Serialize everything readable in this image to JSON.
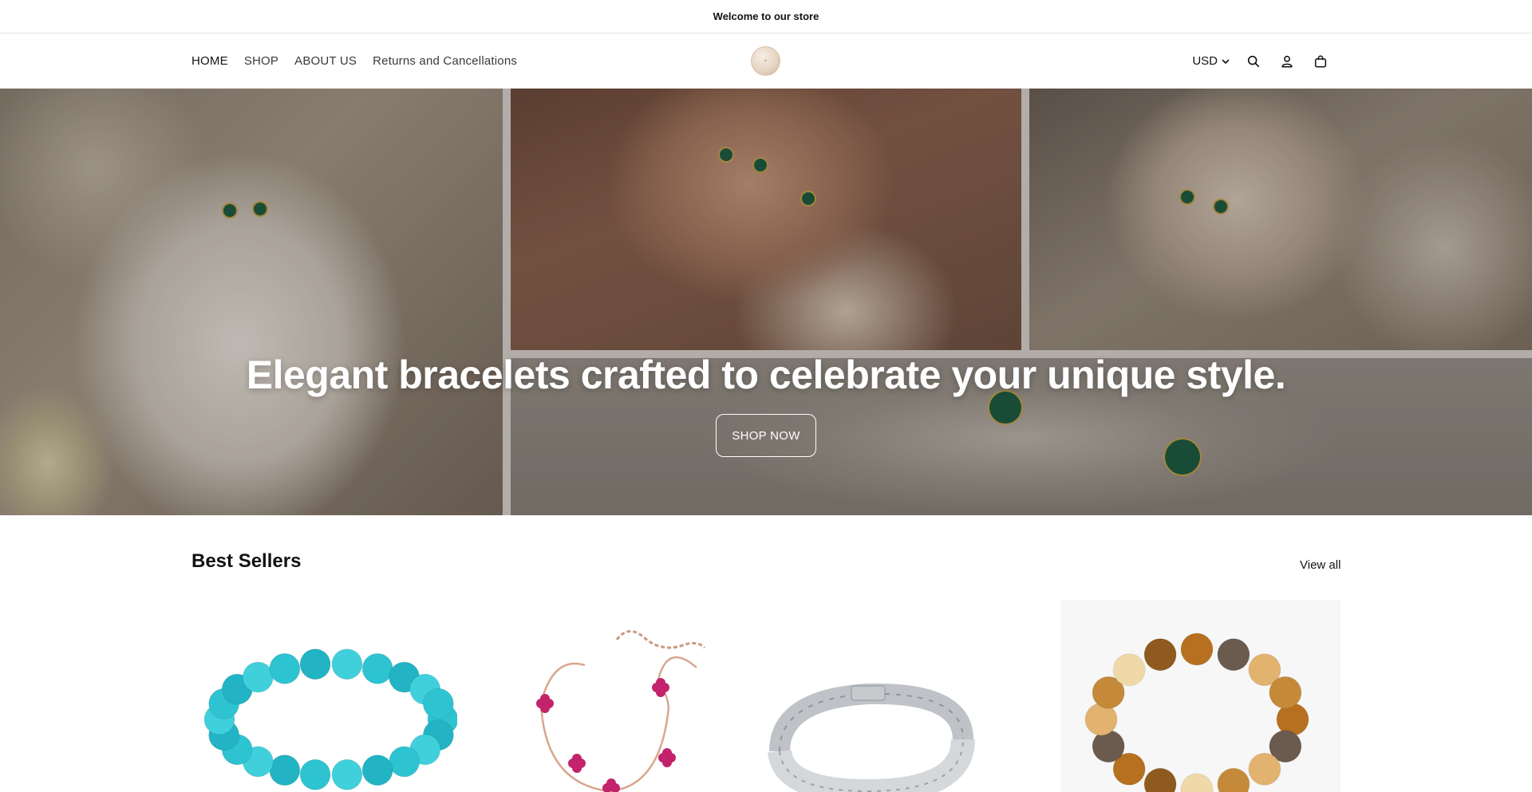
{
  "announcement": {
    "text": "Welcome to our store"
  },
  "nav": {
    "items": [
      {
        "label": "HOME",
        "active": true
      },
      {
        "label": "SHOP",
        "active": false
      },
      {
        "label": "ABOUT US",
        "active": false
      },
      {
        "label": "Returns and Cancellations",
        "active": false
      }
    ]
  },
  "header": {
    "currency": "USD",
    "icons": [
      "search-icon",
      "account-icon",
      "cart-icon"
    ]
  },
  "hero": {
    "title": "Elegant bracelets crafted to celebrate your unique style.",
    "button_label": "SHOP NOW"
  },
  "best_sellers": {
    "title": "Best Sellers",
    "view_all_label": "View all",
    "products": [
      {
        "image": "turquoise-bead-bracelet"
      },
      {
        "image": "rose-gold-pink-clover-bracelet"
      },
      {
        "image": "silver-crystal-tennis-bracelet"
      },
      {
        "image": "tigers-eye-bead-bracelet"
      }
    ]
  },
  "colors": {
    "text": "#121212",
    "accent_green": "#1f5d43",
    "gold": "#c9a44f"
  }
}
